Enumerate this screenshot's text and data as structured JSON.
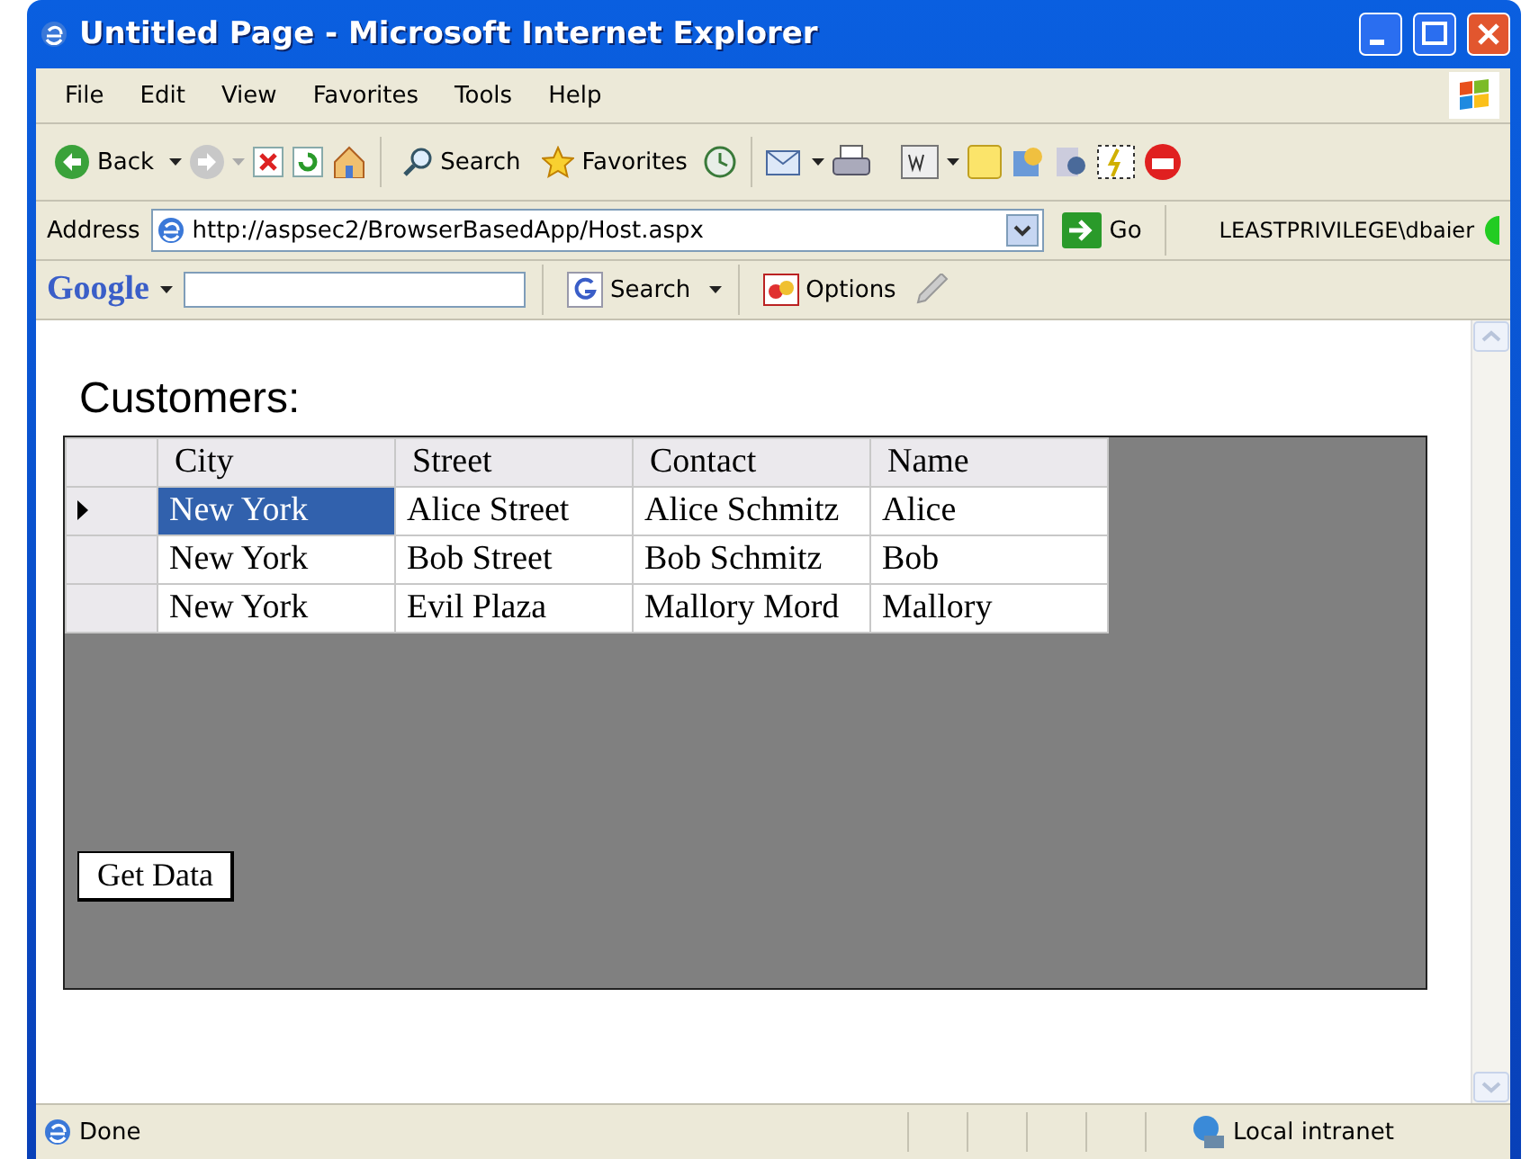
{
  "window": {
    "title": "Untitled Page - Microsoft Internet Explorer"
  },
  "menu": [
    "File",
    "Edit",
    "View",
    "Favorites",
    "Tools",
    "Help"
  ],
  "toolbar": {
    "back": {
      "label": "Back"
    },
    "forward": {
      "disabled": true
    },
    "search": {
      "label": "Search"
    },
    "favorites": {
      "label": "Favorites"
    }
  },
  "address_bar": {
    "label": "Address",
    "url": "http://aspsec2/BrowserBasedApp/Host.aspx",
    "go": "Go",
    "user": "LEASTPRIVILEGE\\dbaier"
  },
  "google_bar": {
    "logo": "Google",
    "search": "Search",
    "options": "Options"
  },
  "page": {
    "heading": "Customers:",
    "table": {
      "columns": [
        "City",
        "Street",
        "Contact",
        "Name"
      ],
      "rows": [
        {
          "selected": true,
          "cells": [
            {
              "text": "New York",
              "selected": true
            },
            {
              "text": "Alice Street",
              "selected": false
            },
            {
              "text": "Alice Schmitz",
              "selected": false
            },
            {
              "text": "Alice",
              "selected": false
            }
          ]
        },
        {
          "selected": false,
          "cells": [
            {
              "text": "New York",
              "selected": false
            },
            {
              "text": "Bob Street",
              "selected": false
            },
            {
              "text": "Bob Schmitz",
              "selected": false
            },
            {
              "text": "Bob",
              "selected": false
            }
          ]
        },
        {
          "selected": false,
          "cells": [
            {
              "text": "New York",
              "selected": false
            },
            {
              "text": "Evil Plaza",
              "selected": false
            },
            {
              "text": "Mallory Mord",
              "selected": false
            },
            {
              "text": "Mallory",
              "selected": false
            }
          ]
        }
      ]
    },
    "button": "Get Data"
  },
  "status_bar": {
    "status": "Done",
    "zone": "Local intranet"
  }
}
